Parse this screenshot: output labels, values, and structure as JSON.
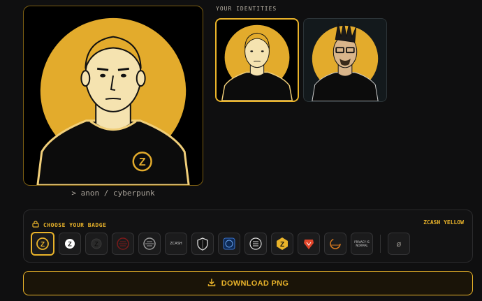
{
  "caption": "> anon / cyberpunk",
  "identities": {
    "label": "YOUR IDENTITIES",
    "items": [
      "anon",
      "cyberpunk"
    ]
  },
  "badges": {
    "title": "CHOOSE YOUR BADGE",
    "selected_name": "ZCASH YELLOW",
    "items": [
      {
        "name": "zcash-yellow",
        "icon": "zcash-coin-icon",
        "selected": true
      },
      {
        "name": "zcash-white",
        "icon": "zcash-coin-icon"
      },
      {
        "name": "zcash-dark",
        "icon": "zcash-coin-icon"
      },
      {
        "name": "red-ring",
        "icon": "ring-logo-icon"
      },
      {
        "name": "grey-ring",
        "icon": "ring-logo-icon"
      },
      {
        "name": "zcash-wordmark",
        "icon": "wordmark-icon",
        "text": "ZCASH"
      },
      {
        "name": "shield",
        "icon": "shield-icon"
      },
      {
        "name": "blue-seal",
        "icon": "seal-icon"
      },
      {
        "name": "zc-emblem",
        "icon": "emblem-icon"
      },
      {
        "name": "zcash-rounded",
        "icon": "zcash-coin-icon"
      },
      {
        "name": "brave",
        "icon": "brave-lion-icon"
      },
      {
        "name": "orange-ring",
        "icon": "ring-logo-icon"
      },
      {
        "name": "privacy-text",
        "icon": "text-logo-icon",
        "text": "PRIVACY IS NORMAL"
      }
    ],
    "none_label": "ø"
  },
  "download": {
    "label": "DOWNLOAD PNG"
  },
  "colors": {
    "accent": "#e9b32a",
    "background": "#0f0f10"
  }
}
